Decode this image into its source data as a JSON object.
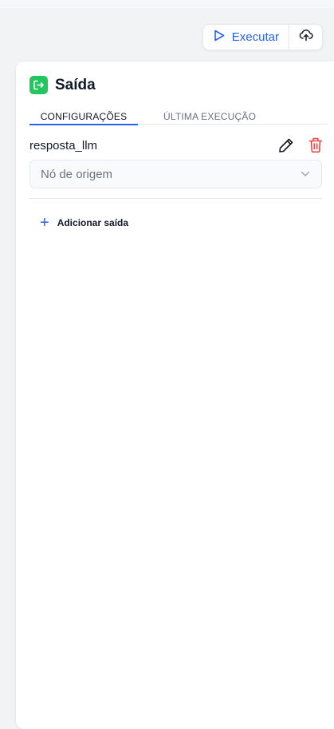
{
  "toolbar": {
    "run_label": "Executar",
    "run_icon": "play-icon",
    "upload_icon": "cloud-upload-icon"
  },
  "panel": {
    "title": "Saída",
    "title_icon": "exit-icon",
    "tabs": [
      {
        "label": "CONFIGURAÇÕES",
        "active": true
      },
      {
        "label": "ÚLTIMA EXECUÇÃO",
        "active": false
      }
    ],
    "output": {
      "name": "resposta_llm",
      "edit_icon": "pencil-icon",
      "delete_icon": "trash-icon",
      "source_placeholder": "Nó de origem"
    },
    "add_output_label": "Adicionar saída"
  },
  "colors": {
    "accent": "#2563eb",
    "brand_green": "#22c55e",
    "danger": "#ef4444"
  }
}
